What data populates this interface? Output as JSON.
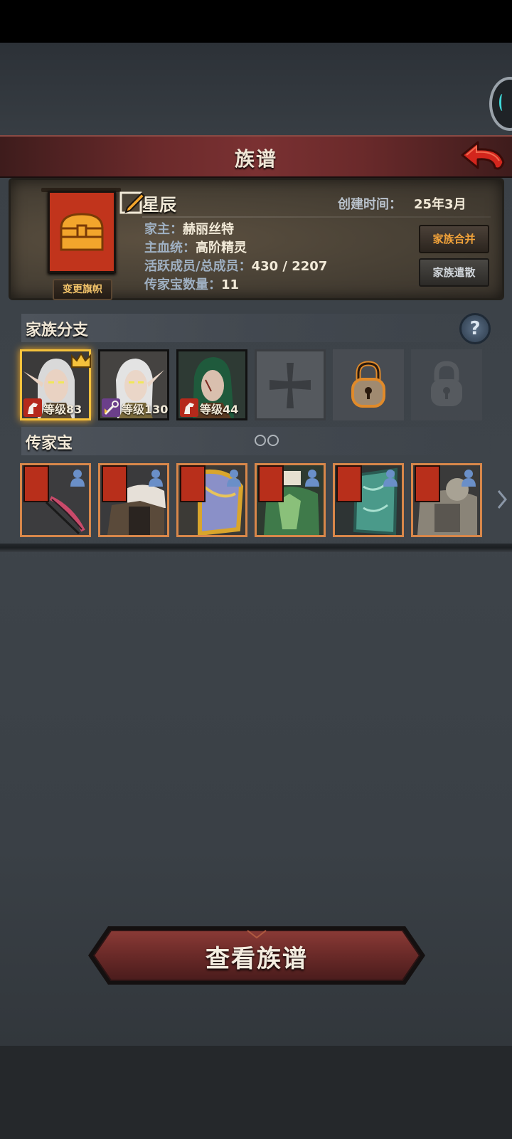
{
  "header": {
    "title": "族谱"
  },
  "clan": {
    "name": "星辰",
    "created_label": "创建时间：",
    "created_value": "25年3月",
    "change_banner_label": "变更旗帜",
    "rows": [
      {
        "key": "家主：",
        "value": "赫丽丝特"
      },
      {
        "key": "主血统：",
        "value": "高阶精灵"
      },
      {
        "key": "活跃成员/总成员：",
        "value": "430 / 2207"
      },
      {
        "key": "传家宝数量：",
        "value": "11"
      }
    ],
    "merge_label": "家族合并",
    "disband_label": "家族遣散"
  },
  "branches": {
    "title": "家族分支",
    "members": [
      {
        "level_label": "等级83",
        "leader": true,
        "class_icon": "horse-icon"
      },
      {
        "level_label": "等级130",
        "leader": false,
        "class_icon": "staff-icon"
      },
      {
        "level_label": "等级44",
        "leader": false,
        "class_icon": "horse-icon"
      }
    ]
  },
  "heirlooms": {
    "title": "传家宝",
    "items": [
      "bow-icon",
      "fur-armor-icon",
      "golden-shield-icon",
      "green-armor-icon",
      "jade-shield-icon",
      "silver-armor-icon"
    ]
  },
  "footer": {
    "view_tree_label": "查看族谱"
  },
  "colors": {
    "accent_red": "#c1341c",
    "accent_gold": "#f5c23c",
    "frame_orange": "#d8874a"
  }
}
